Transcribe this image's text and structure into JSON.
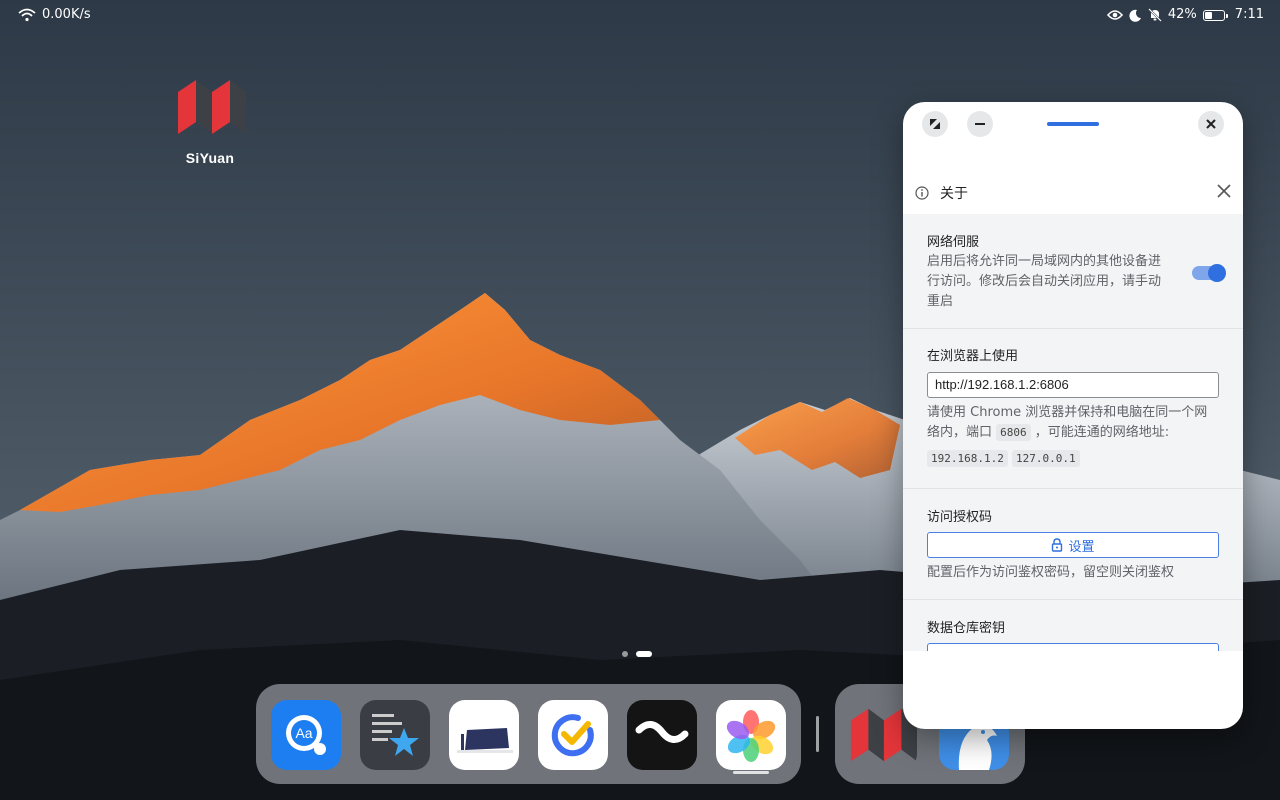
{
  "status_bar": {
    "network_speed": "0.00K/s",
    "battery_percent": "42%",
    "battery_level": 0.42,
    "time": "7:11"
  },
  "desktop": {
    "apps": [
      {
        "label": "SiYuan",
        "icon": "siyuan-logo"
      }
    ],
    "page_count": 2,
    "active_page": 2
  },
  "dock": {
    "apps": [
      {
        "icon": "dictionary-app-icon"
      },
      {
        "icon": "notes-star-app-icon"
      },
      {
        "icon": "slides-app-icon"
      },
      {
        "icon": "ticktick-app-icon"
      },
      {
        "icon": "wave-app-icon"
      },
      {
        "icon": "photos-app-icon"
      }
    ],
    "recent_apps": [
      {
        "icon": "siyuan-app-icon"
      },
      {
        "icon": "bird-app-icon"
      }
    ]
  },
  "window": {
    "dialog": {
      "title": "关于",
      "sections": {
        "network_serve": {
          "title": "网络伺服",
          "desc_lines": [
            "启用后将允许同一局域网内的其他设备进",
            "行访问。修改后会自动关闭应用，请手动",
            "重启"
          ],
          "enabled": true
        },
        "browser": {
          "title": "在浏览器上使用",
          "url": "http://192.168.1.2:6806",
          "desc_line1": "请使用 Chrome 浏览器并保持和电脑在同一个网",
          "desc_line2_a": "络内，端口",
          "port": "6806",
          "desc_line2_b": "，可能连通的网络地址:",
          "addresses": [
            "192.168.1.2",
            "127.0.0.1"
          ]
        },
        "access_code": {
          "title": "访问授权码",
          "button_label": "设置",
          "desc": "配置后作为访问鉴权密码，留空则关闭鉴权"
        },
        "repo_key": {
          "title": "数据仓库密钥"
        }
      }
    }
  },
  "colors": {
    "accent": "#2f6fe0",
    "window_bg": "#ffffff",
    "section_bg": "#f3f4f6"
  }
}
